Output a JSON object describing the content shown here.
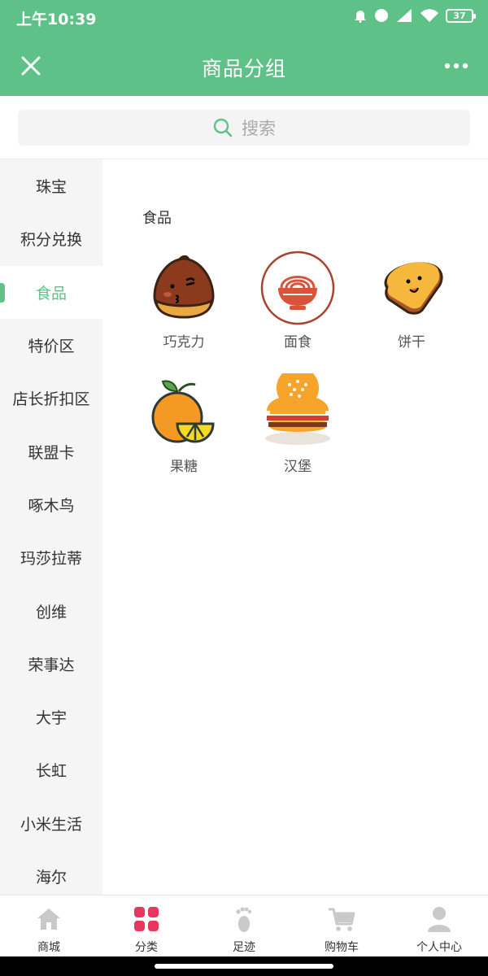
{
  "status": {
    "time": "上午10:39",
    "battery": "37"
  },
  "nav": {
    "title": "商品分组",
    "close_icon": "close-icon",
    "more_icon": "more-icon"
  },
  "search": {
    "placeholder": "搜索",
    "icon": "search-icon"
  },
  "sidebar": {
    "active_index": 2,
    "items": [
      {
        "label": "珠宝"
      },
      {
        "label": "积分兑换"
      },
      {
        "label": "食品"
      },
      {
        "label": "特价区"
      },
      {
        "label": "店长折扣区"
      },
      {
        "label": "联盟卡"
      },
      {
        "label": "啄木鸟"
      },
      {
        "label": "玛莎拉蒂"
      },
      {
        "label": "创维"
      },
      {
        "label": "荣事达"
      },
      {
        "label": "大宇"
      },
      {
        "label": "长虹"
      },
      {
        "label": "小米生活"
      },
      {
        "label": "海尔"
      }
    ]
  },
  "content": {
    "section_title": "食品",
    "items": [
      {
        "label": "巧克力",
        "icon": "chestnut-icon"
      },
      {
        "label": "面食",
        "icon": "noodle-bowl-icon"
      },
      {
        "label": "饼干",
        "icon": "toast-icon"
      },
      {
        "label": "果糖",
        "icon": "orange-lemon-icon"
      },
      {
        "label": "汉堡",
        "icon": "burger-icon"
      }
    ]
  },
  "tabbar": {
    "active_index": 1,
    "items": [
      {
        "label": "商城",
        "icon": "home-icon"
      },
      {
        "label": "分类",
        "icon": "category-icon"
      },
      {
        "label": "足迹",
        "icon": "footprint-icon"
      },
      {
        "label": "购物车",
        "icon": "cart-icon"
      },
      {
        "label": "个人中心",
        "icon": "user-icon"
      }
    ]
  },
  "colors": {
    "brand": "#5ec187",
    "active_tab": "#e8375f",
    "inactive_icon": "#c9c9c9"
  }
}
